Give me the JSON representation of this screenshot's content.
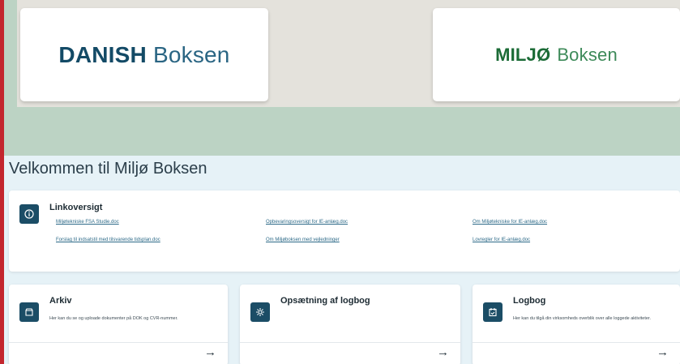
{
  "logos": {
    "danish": {
      "bold": "DANISH",
      "light": "Boksen"
    },
    "miljo": {
      "bold": "MILJØ",
      "light": "Boksen"
    }
  },
  "welcome_title": "Velkommen til Miljø Boksen",
  "link_overview": {
    "title": "Linkoversigt",
    "icon": "info-icon",
    "links": [
      "Miljøtekniske FSA Studie.doc",
      "Forslag til indsatstil med tilsvarende tidsplan.doc",
      "Opbevaringsoversigt for IE-anlæg.doc",
      "Om Miljøboksen med vejledninger",
      "Om Miljøtekniske for IE-anlæg.doc",
      "Lovregler for IE-anlæg.doc"
    ]
  },
  "tiles": [
    {
      "title": "Arkiv",
      "icon": "archive-icon",
      "desc": "Her kan du se og uploade dokumenter på DOK og CVR-nummer.",
      "arrow": "→"
    },
    {
      "title": "Opsætning af logbog",
      "icon": "gear-icon",
      "desc": "",
      "arrow": "→"
    },
    {
      "title": "Logbog",
      "icon": "logbook-icon",
      "desc": "Her kan du tilgå din virksomheds overblik over alle loggede aktiviteter.",
      "arrow": "→"
    }
  ],
  "colors": {
    "accent_dark": "#1b4d66",
    "danish_blue": "#134a66",
    "miljo_green": "#1b6b36",
    "band_green": "#bcd3c4",
    "page_bg": "#e6f2f7",
    "left_rule": "#c3262e"
  }
}
